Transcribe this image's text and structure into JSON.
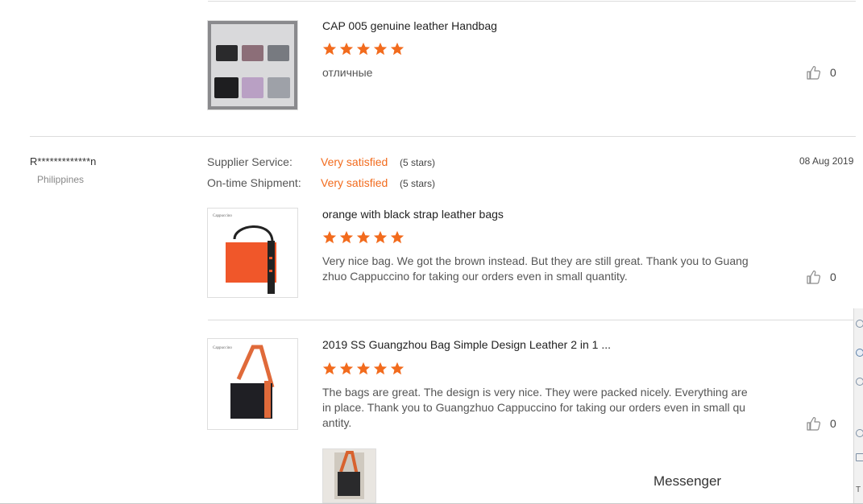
{
  "colors": {
    "accent": "#f26b1d",
    "star": "#f26b1d",
    "divider": "#dcdcdc"
  },
  "reviews": [
    {
      "product_title": "CAP 005 genuine leather Handbag",
      "rating": 5,
      "comment": "отличные",
      "likes": "0"
    }
  ],
  "reviewer": {
    "name": "R*************n",
    "country": "Philippines",
    "date": "08 Aug 2019",
    "supplier_service": {
      "label": "Supplier Service:",
      "value": "Very satisfied",
      "stars_note": "(5 stars)"
    },
    "ontime_shipment": {
      "label": "On-time Shipment:",
      "value": "Very satisfied",
      "stars_note": "(5 stars)"
    },
    "items": [
      {
        "product_title": "orange with black strap leather bags",
        "rating": 5,
        "comment": "Very nice bag. We got the brown instead. But they are still great. Thank you to Guangzhuo Cappuccino for taking our orders even in small quantity.",
        "likes": "0"
      },
      {
        "product_title": "2019 SS Guangzhou Bag Simple Design Leather 2 in 1 ...",
        "rating": 5,
        "comment": "The bags are great. The design is very nice. They were packed nicely. Everything are in place. Thank you to Guangzhuo Cappuccino for taking our orders even in small quantity.",
        "likes": "0"
      }
    ]
  },
  "messenger_label": "Messenger",
  "icons": {
    "like": "thumbs-up-icon",
    "star": "star-icon"
  }
}
